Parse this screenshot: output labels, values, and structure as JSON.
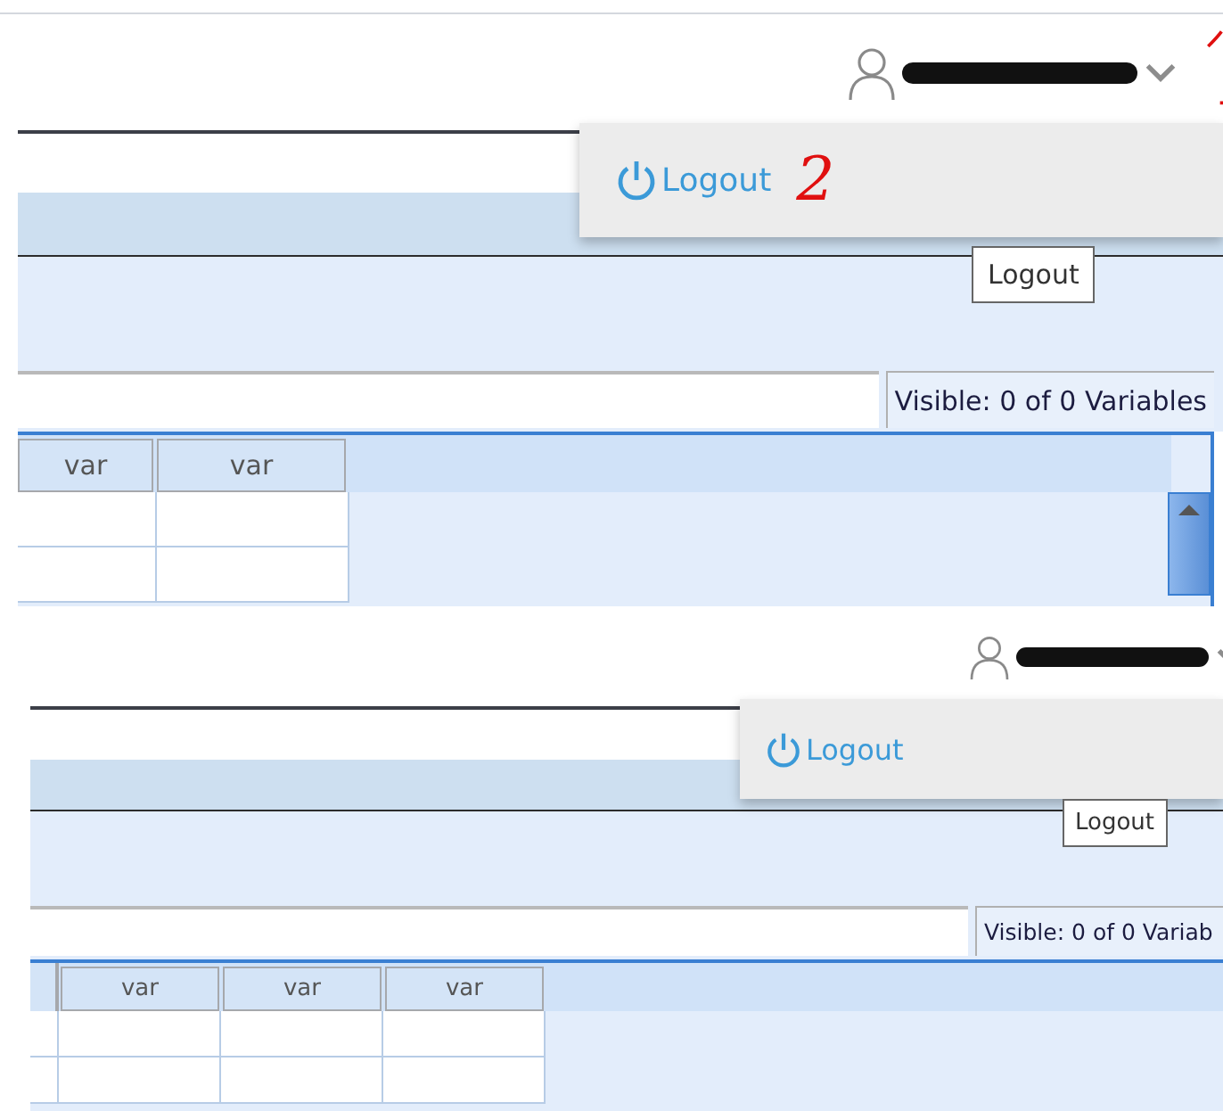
{
  "panels": [
    {
      "user_menu": {
        "expanded": true
      },
      "menu_items": [
        {
          "label": "Logout",
          "annotation": "2"
        }
      ],
      "tooltip": "Logout",
      "status": "Visible: 0 of 0 Variables",
      "columns": [
        "var",
        "var"
      ]
    },
    {
      "user_menu": {
        "expanded": true
      },
      "menu_items": [
        {
          "label": "Logout"
        }
      ],
      "tooltip": "Logout",
      "status": "Visible: 0 of 0 Variab",
      "columns": [
        "var",
        "var",
        "var"
      ]
    }
  ]
}
